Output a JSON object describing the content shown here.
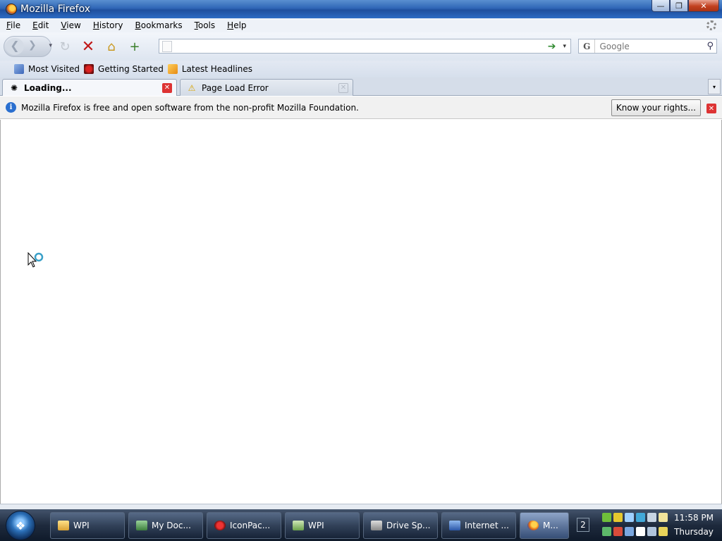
{
  "window": {
    "title": "Mozilla Firefox",
    "minimize": "—",
    "maximize": "❐",
    "close": "✕"
  },
  "menubar": {
    "items": [
      "File",
      "Edit",
      "View",
      "History",
      "Bookmarks",
      "Tools",
      "Help"
    ]
  },
  "navbar": {
    "back": "❮",
    "forward": "❯",
    "history_dropdown": "▾",
    "reload": "↻",
    "stop": "✕",
    "home": "⌂",
    "new_tab": "+",
    "url_value": "",
    "go": "➔",
    "url_dropdown": "▾",
    "search_engine": "G",
    "search_placeholder": "Google",
    "search_icon": "⚲"
  },
  "bookmarks": [
    {
      "label": "Most Visited",
      "icon": "most-visited-icon"
    },
    {
      "label": "Getting Started",
      "icon": "getting-started-icon"
    },
    {
      "label": "Latest Headlines",
      "icon": "rss-icon"
    }
  ],
  "tabs": [
    {
      "label": "Loading...",
      "icon": "✺",
      "close": "✕",
      "active": true
    },
    {
      "label": "Page Load Error",
      "icon": "⚠",
      "close": "✕",
      "active": false
    }
  ],
  "tabs_menu": "▾",
  "notification": {
    "info_icon": "i",
    "message": "Mozilla Firefox is free and open software from the non-profit Mozilla Foundation.",
    "button": "Know your rights...",
    "close": "✕"
  },
  "taskbar": {
    "start_glyph": "❖",
    "buttons": [
      {
        "label": "WPI",
        "icon": "folder-icon"
      },
      {
        "label": "My Doc...",
        "icon": "document-icon"
      },
      {
        "label": "IconPac...",
        "icon": "iconpackager-icon"
      },
      {
        "label": "WPI",
        "icon": "wpi-icon"
      },
      {
        "label": "Drive Sp...",
        "icon": "drive-icon"
      },
      {
        "label": "Internet ...",
        "icon": "internet-icon"
      },
      {
        "label": "M...",
        "icon": "firefox-icon",
        "active": true
      }
    ],
    "quick_glyph": "2",
    "clock_time": "11:58 PM",
    "clock_day": "Thursday",
    "tray_colors": [
      "#6fbf3a",
      "#e6c82e",
      "#9fd0ff",
      "#42a8d8",
      "#c7d4e2",
      "#f0e39a",
      "#5db96a",
      "#d84b3a",
      "#7aa7e0",
      "#ffffff",
      "#b0c4dc",
      "#e8d35a"
    ]
  }
}
